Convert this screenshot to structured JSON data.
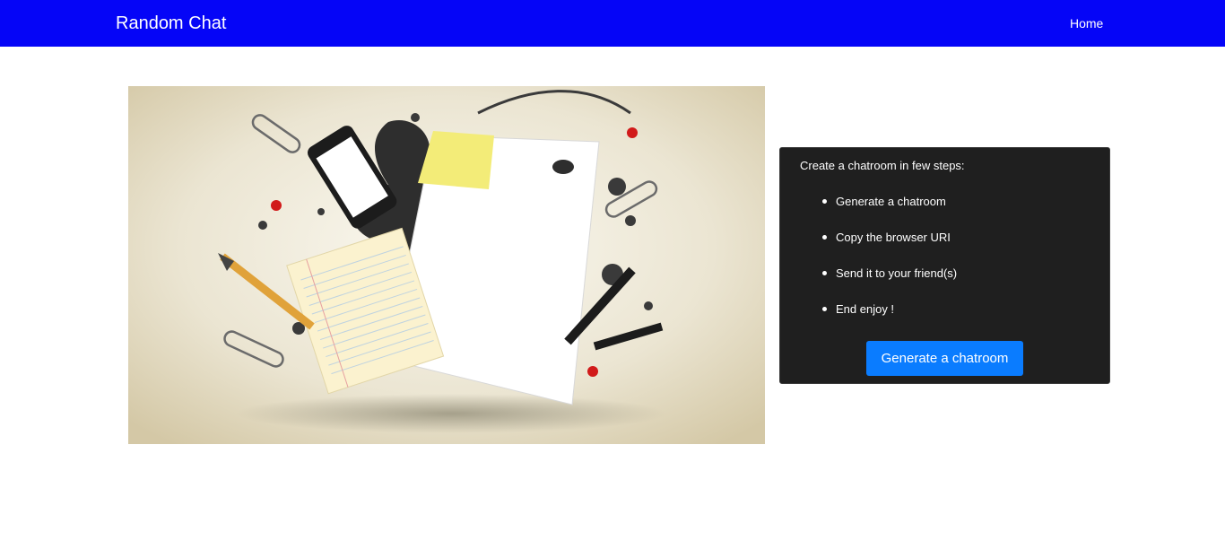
{
  "navbar": {
    "brand": "Random Chat",
    "home_label": "Home"
  },
  "hero": {
    "icon": "stationery-illustration"
  },
  "card": {
    "title": "Create a chatroom in few steps:",
    "steps": [
      "Generate a chatroom",
      "Copy the browser URI",
      "Send it to your friend(s)",
      "End enjoy !"
    ],
    "button_label": "Generate a chatroom"
  },
  "colors": {
    "navbar": "#0505f7",
    "card_bg": "#1f1f1f",
    "button": "#0a7cff"
  }
}
